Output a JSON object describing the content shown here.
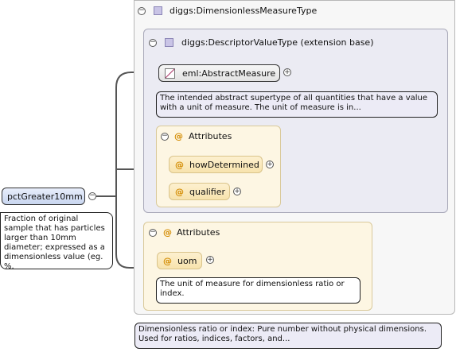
{
  "root": {
    "name": "pctGreater10mm",
    "doc": "Fraction of original sample that has particles larger than 10mm diameter; expressed as a dimensionless value (eg. %."
  },
  "type": {
    "name": "diggs:DimensionlessMeasureType",
    "doc": "Dimensionless ratio or index: Pure number without physical dimensions. Used for ratios, indices, factors, and..."
  },
  "base": {
    "name": "diggs:DescriptorValueType (extension base)",
    "element": "eml:AbstractMeasure",
    "element_doc": "The intended abstract supertype of all quantities that have a value with a unit of measure. The unit of measure is in...",
    "attributes_title": "Attributes",
    "attributes": [
      "howDetermined",
      "qualifier"
    ]
  },
  "own_attributes": {
    "title": "Attributes",
    "attribute": "uom",
    "doc": "The unit of measure for dimensionless ratio or index."
  },
  "symbols": {
    "at": "@",
    "minus": "−",
    "plus": "+"
  },
  "colors": {
    "root_fill": "#c9d6f0",
    "extension_fill": "#ebebf3",
    "attributes_fill": "#fdf6e3",
    "attribute_box": "#f7e3ad",
    "attribute_symbol": "#d38b00",
    "type_icon": "#c9c4e6"
  }
}
